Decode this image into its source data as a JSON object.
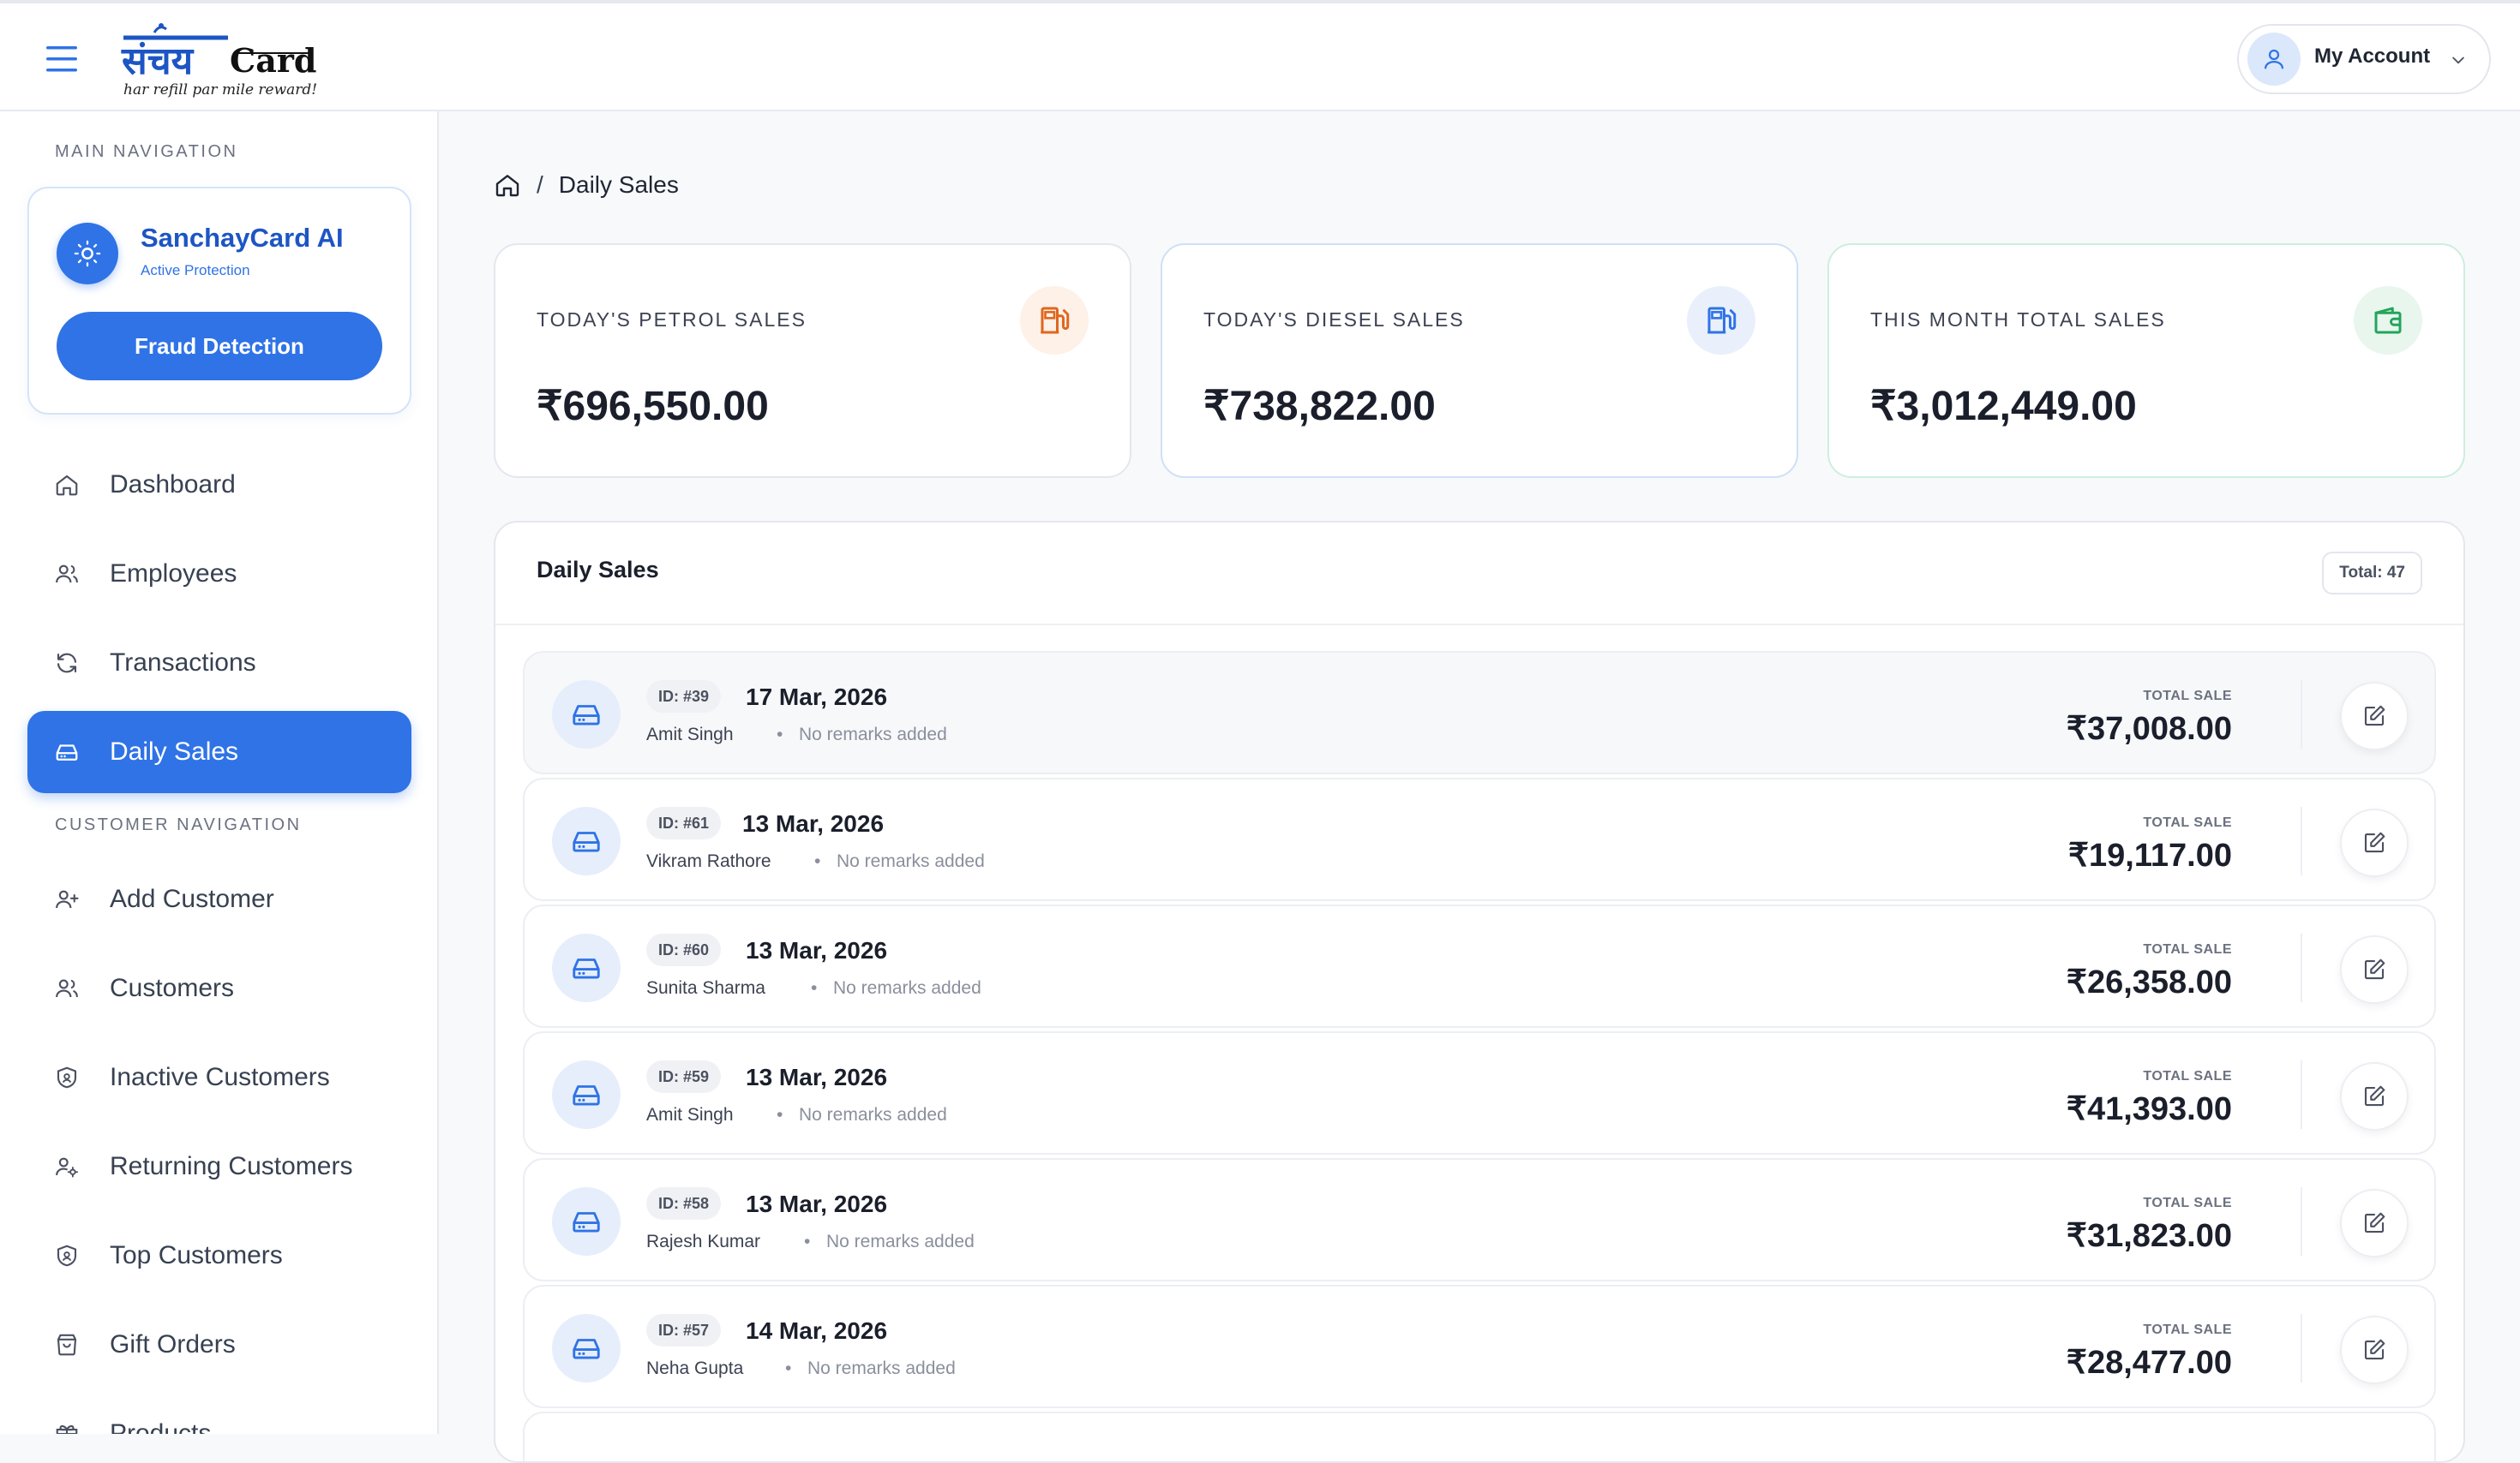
{
  "logo": {
    "brand_native": "संचय",
    "brand_latin": "Card",
    "tagline": "har refill par mile reward!"
  },
  "account": {
    "label": "My Account"
  },
  "sidebar": {
    "main_title": "MAIN NAVIGATION",
    "ai": {
      "title": "SanchayCard AI",
      "subtitle": "Active Protection",
      "button": "Fraud Detection"
    },
    "main_items": [
      {
        "label": "Dashboard",
        "icon": "home-icon"
      },
      {
        "label": "Employees",
        "icon": "users-icon"
      },
      {
        "label": "Transactions",
        "icon": "refresh-icon"
      },
      {
        "label": "Daily Sales",
        "icon": "drive-icon",
        "active": true
      }
    ],
    "customer_title": "CUSTOMER NAVIGATION",
    "customer_items": [
      {
        "label": "Add Customer",
        "icon": "user-plus-icon"
      },
      {
        "label": "Customers",
        "icon": "users-icon"
      },
      {
        "label": "Inactive Customers",
        "icon": "shield-icon"
      },
      {
        "label": "Returning Customers",
        "icon": "user-cog-icon"
      },
      {
        "label": "Top Customers",
        "icon": "shield-icon"
      },
      {
        "label": "Gift Orders",
        "icon": "shopping-bag-icon"
      },
      {
        "label": "Products",
        "icon": "gift-icon"
      }
    ]
  },
  "breadcrumb": {
    "separator": "/",
    "current": "Daily Sales"
  },
  "stats": [
    {
      "label": "TODAY'S PETROL SALES",
      "value": "₹696,550.00",
      "icon": "fuel-pump-icon",
      "accent": "#e0661e",
      "iconBg": "#fdf1e8",
      "border": "#e4e7ed"
    },
    {
      "label": "TODAY'S DIESEL SALES",
      "value": "₹738,822.00",
      "icon": "fuel-pump-icon",
      "accent": "#2f73e6",
      "iconBg": "#e9f0fb",
      "border": "#cfe0f6"
    },
    {
      "label": "THIS MONTH TOTAL SALES",
      "value": "₹3,012,449.00",
      "icon": "wallet-icon",
      "accent": "#22a55b",
      "iconBg": "#e8f6ee",
      "border": "#cdeedd"
    }
  ],
  "panel": {
    "title": "Daily Sales",
    "total": "Total: 47"
  },
  "sales": [
    {
      "id": "ID: #39",
      "date": "17 Mar, 2026",
      "person": "Amit Singh",
      "remark": "No remarks added",
      "label": "TOTAL SALE",
      "amount": "₹37,008.00"
    },
    {
      "id": "ID: #61",
      "date": "13 Mar, 2026",
      "person": "Vikram Rathore",
      "remark": "No remarks added",
      "label": "TOTAL SALE",
      "amount": "₹19,117.00"
    },
    {
      "id": "ID: #60",
      "date": "13 Mar, 2026",
      "person": "Sunita Sharma",
      "remark": "No remarks added",
      "label": "TOTAL SALE",
      "amount": "₹26,358.00"
    },
    {
      "id": "ID: #59",
      "date": "13 Mar, 2026",
      "person": "Amit Singh",
      "remark": "No remarks added",
      "label": "TOTAL SALE",
      "amount": "₹41,393.00"
    },
    {
      "id": "ID: #58",
      "date": "13 Mar, 2026",
      "person": "Rajesh Kumar",
      "remark": "No remarks added",
      "label": "TOTAL SALE",
      "amount": "₹31,823.00"
    },
    {
      "id": "ID: #57",
      "date": "14 Mar, 2026",
      "person": "Neha Gupta",
      "remark": "No remarks added",
      "label": "TOTAL SALE",
      "amount": "₹28,477.00"
    }
  ]
}
